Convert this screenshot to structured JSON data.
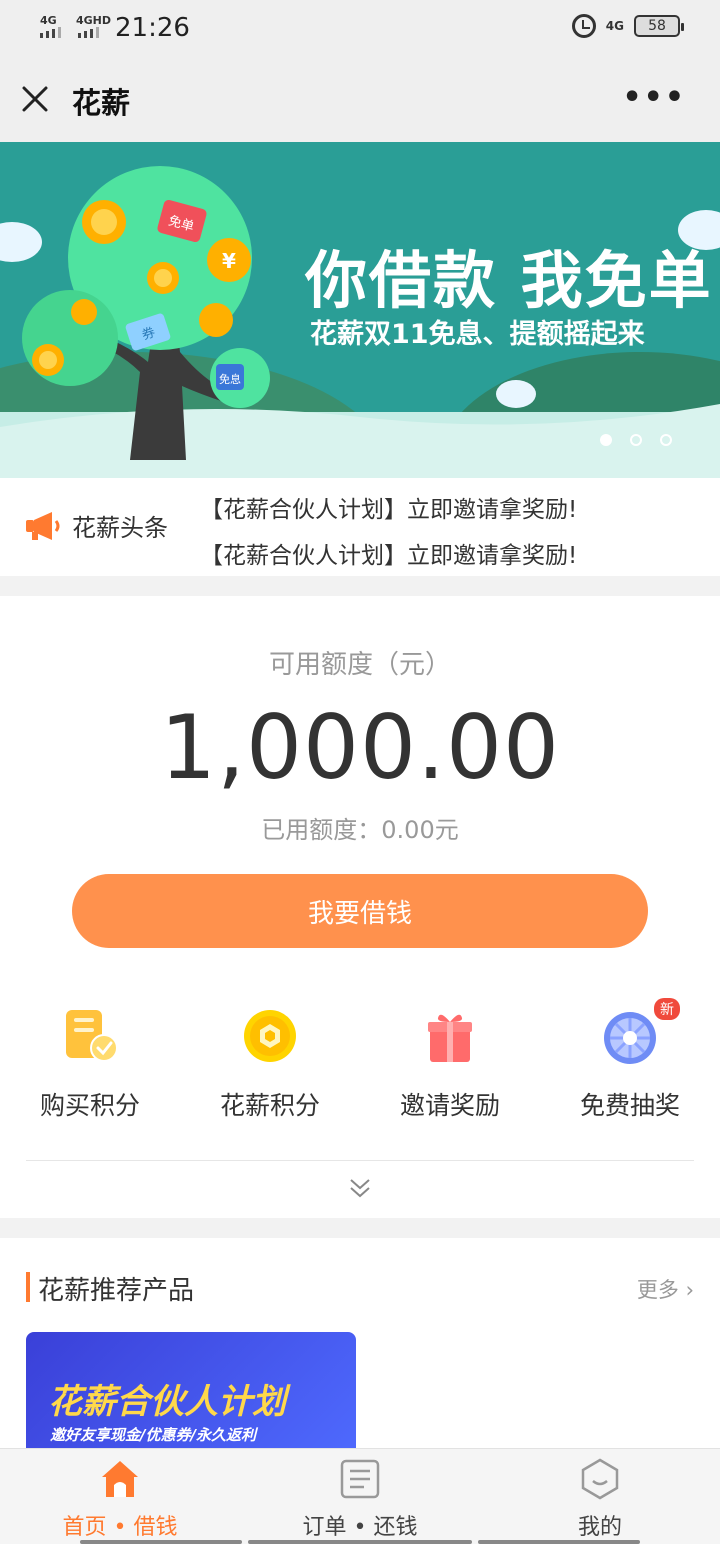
{
  "status_bar": {
    "net1": "4G",
    "net2": "4GHD",
    "time": "21:26",
    "net3": "4G",
    "battery": "58"
  },
  "nav": {
    "close_icon": "close-icon",
    "title": "花薪",
    "more_icon": "more-icon",
    "more_glyph": "•••"
  },
  "banner": {
    "title": "你借款 我免单",
    "subtitle": "花薪双11免息、提额摇起来",
    "tags": [
      "免单",
      "券",
      "免息"
    ],
    "coin_symbol": "¥",
    "page_count": 3,
    "active_page": 1
  },
  "headline": {
    "label": "花薪头条",
    "items": [
      "【花薪合伙人计划】立即邀请拿奖励!",
      "【花薪合伙人计划】立即邀请拿奖励!"
    ]
  },
  "credit": {
    "label": "可用额度（元）",
    "amount": "1,000.00",
    "used": "已用额度：0.00元",
    "button": "我要借钱"
  },
  "quick_actions": [
    {
      "label": "购买积分",
      "icon": "points-purchase-icon"
    },
    {
      "label": "花薪积分",
      "icon": "points-coin-icon"
    },
    {
      "label": "邀请奖励",
      "icon": "gift-icon"
    },
    {
      "label": "免费抽奖",
      "icon": "lottery-wheel-icon",
      "badge": "新"
    }
  ],
  "recommend": {
    "title": "花薪推荐产品",
    "more": "更多",
    "card_title": "花薪合伙人计划",
    "card_subtitle": "邀好友享现金/优惠券/永久返利"
  },
  "tabs": [
    {
      "label": "首页 • 借钱",
      "icon": "home-icon",
      "active": true
    },
    {
      "label": "订单 • 还钱",
      "icon": "order-icon",
      "active": false
    },
    {
      "label": "我的",
      "icon": "profile-icon",
      "active": false
    }
  ],
  "colors": {
    "accent": "#ff914d",
    "banner_bg": "#2a9e96",
    "tab_active": "#ff7a30"
  }
}
